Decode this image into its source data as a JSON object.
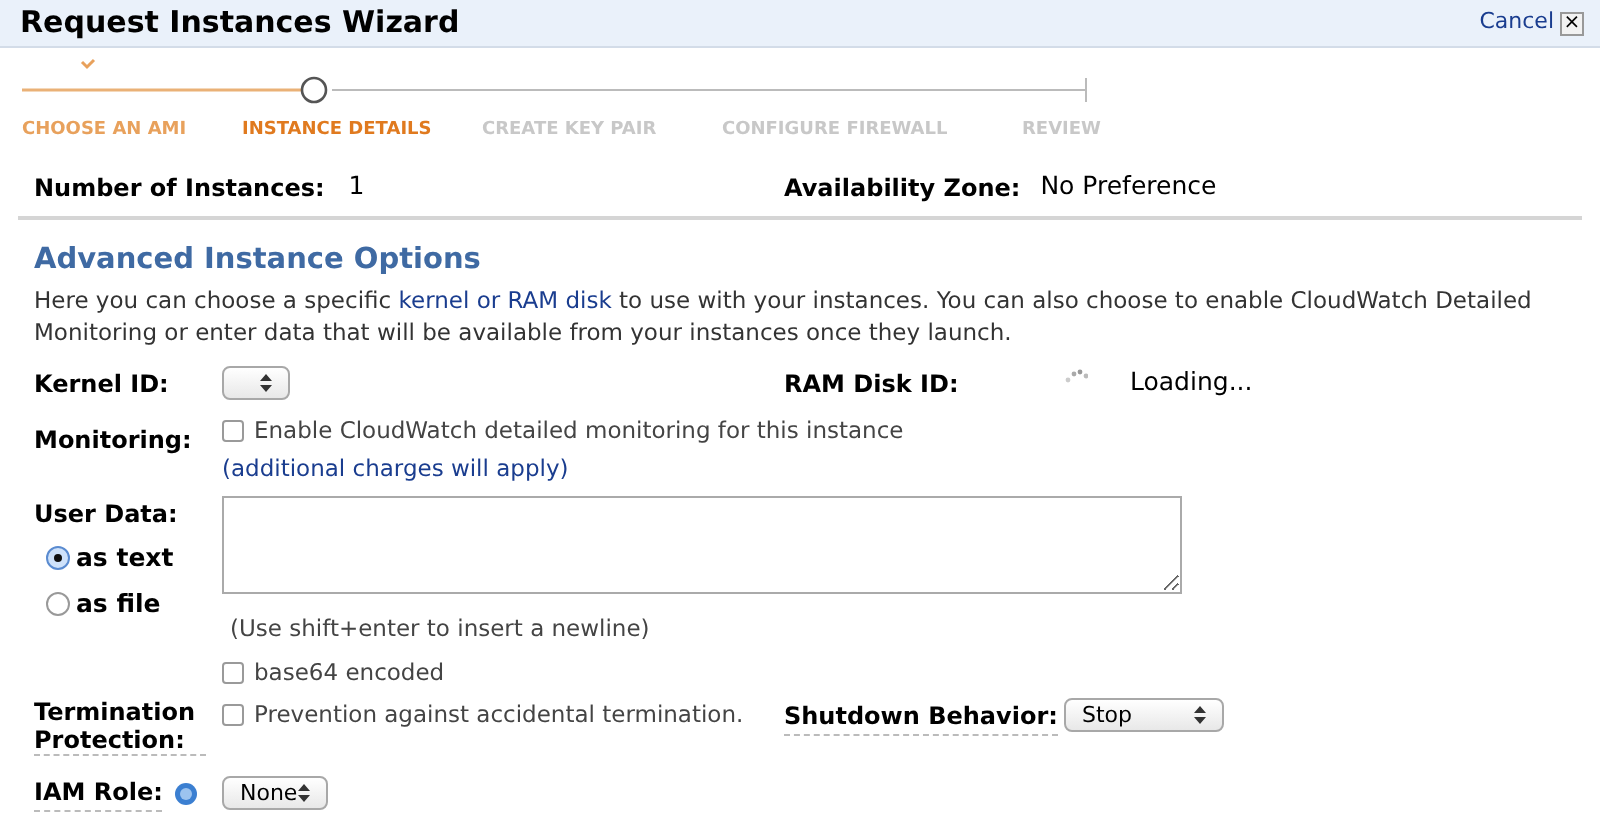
{
  "window": {
    "title": "Request Instances Wizard",
    "cancel": "Cancel",
    "close": "×"
  },
  "steps": [
    {
      "label": "CHOOSE AN AMI",
      "completed": true,
      "selected": false
    },
    {
      "label": "INSTANCE DETAILS",
      "completed": false,
      "selected": true
    },
    {
      "label": "CREATE KEY PAIR",
      "completed": false,
      "selected": false
    },
    {
      "label": "CONFIGURE FIREWALL",
      "completed": false,
      "selected": false
    },
    {
      "label": "REVIEW",
      "completed": false,
      "selected": false
    }
  ],
  "summary": {
    "instances_label": "Number of Instances:",
    "instances_value": "1",
    "zone_label": "Availability Zone:",
    "zone_value": "No Preference"
  },
  "advanced": {
    "heading": "Advanced Instance Options",
    "intro_before": "Here you can choose a specific",
    "intro_link": "kernel or RAM disk",
    "intro_after": "to use with your instances. You can also choose to enable CloudWatch Detailed Monitoring or enter data that will be available from your instances once they launch.",
    "kernel_label": "Kernel ID:",
    "ramdisk_label": "RAM Disk ID:",
    "ramdisk_value": "Loading...",
    "monitoring_label": "Monitoring:",
    "monitoring": {
      "label": "Enable CloudWatch detailed monitoring for this instance",
      "checked": false
    },
    "monitoring_link": "(additional charges will apply)",
    "user_data_label": "User Data:",
    "user_data_modes": [
      {
        "label": "as text",
        "selected": true
      },
      {
        "label": "as file",
        "selected": false
      }
    ],
    "user_data_hint": "(Use shift+enter to insert a newline)",
    "base64": {
      "label": "base64 encoded",
      "checked": false
    },
    "termination_label": "Termination Protection:",
    "termination": {
      "label": "Prevention against accidental termination.",
      "checked": false
    },
    "shutdown_label": "Shutdown Behavior:",
    "shutdown_value": "Stop",
    "iam_label": "IAM Role:",
    "iam_value": "None"
  }
}
